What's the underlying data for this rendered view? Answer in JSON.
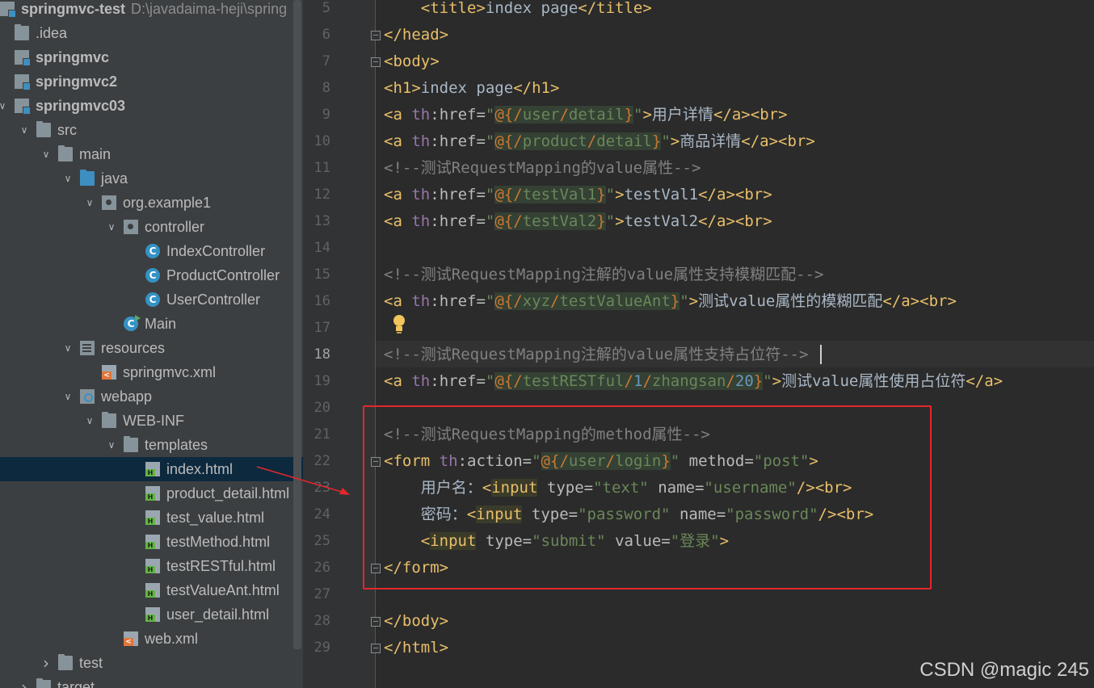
{
  "project_tree": {
    "root": {
      "name": "springmvc-test",
      "path": "D:\\javadaima-heji\\spring"
    },
    "items": [
      {
        "label": "springmvc-test",
        "icon": "module-folder-icon"
      },
      {
        "label": ".idea",
        "icon": "folder-icon"
      },
      {
        "label": "springmvc",
        "icon": "module-folder-icon"
      },
      {
        "label": "springmvc2",
        "icon": "module-folder-icon"
      },
      {
        "label": "springmvc03",
        "icon": "module-folder-icon"
      },
      {
        "label": "src",
        "icon": "folder-icon"
      },
      {
        "label": "main",
        "icon": "folder-icon"
      },
      {
        "label": "java",
        "icon": "source-folder-icon"
      },
      {
        "label": "org.example1",
        "icon": "package-icon"
      },
      {
        "label": "controller",
        "icon": "package-icon"
      },
      {
        "label": "IndexController",
        "icon": "java-class-icon"
      },
      {
        "label": "ProductController",
        "icon": "java-class-icon"
      },
      {
        "label": "UserController",
        "icon": "java-class-icon"
      },
      {
        "label": "Main",
        "icon": "java-main-class-icon"
      },
      {
        "label": "resources",
        "icon": "resources-folder-icon"
      },
      {
        "label": "springmvc.xml",
        "icon": "xml-file-icon"
      },
      {
        "label": "webapp",
        "icon": "web-folder-icon"
      },
      {
        "label": "WEB-INF",
        "icon": "folder-icon"
      },
      {
        "label": "templates",
        "icon": "folder-icon"
      },
      {
        "label": "index.html",
        "icon": "html-file-icon"
      },
      {
        "label": "product_detail.html",
        "icon": "html-file-icon"
      },
      {
        "label": "test_value.html",
        "icon": "html-file-icon"
      },
      {
        "label": "testMethod.html",
        "icon": "html-file-icon"
      },
      {
        "label": "testRESTful.html",
        "icon": "html-file-icon"
      },
      {
        "label": "testValueAnt.html",
        "icon": "html-file-icon"
      },
      {
        "label": "user_detail.html",
        "icon": "html-file-icon"
      },
      {
        "label": "web.xml",
        "icon": "xml-file-icon"
      },
      {
        "label": "test",
        "icon": "folder-icon"
      },
      {
        "label": "target",
        "icon": "excluded-folder-icon"
      }
    ],
    "selected": "index.html"
  },
  "editor": {
    "current_line": 18,
    "line_numbers": [
      "5",
      "6",
      "7",
      "8",
      "9",
      "10",
      "11",
      "12",
      "13",
      "14",
      "15",
      "16",
      "17",
      "18",
      "19",
      "20",
      "21",
      "22",
      "23",
      "24",
      "25",
      "26",
      "27",
      "28",
      "29"
    ],
    "code": {
      "l5": "    <title>index page</title>",
      "l6": "</head>",
      "l7": "<body>",
      "l8": "<h1>index page</h1>",
      "l9": "<a th:href=\"@{/user/detail}\">用户详情</a><br>",
      "l10": "<a th:href=\"@{/product/detail}\">商品详情</a><br>",
      "l11": "<!--测试RequestMapping的value属性-->",
      "l12": "<a th:href=\"@{/testVal1}\">testVal1</a><br>",
      "l13": "<a th:href=\"@{/testVal2}\">testVal2</a><br>",
      "l14": "",
      "l15": "<!--测试RequestMapping注解的value属性支持模糊匹配-->",
      "l16": "<a th:href=\"@{/xyz/testValueAnt}\">测试value属性的模糊匹配</a><br>",
      "l17": "",
      "l18": "<!--测试RequestMapping注解的value属性支持占位符-->",
      "l19": "<a th:href=\"@{/testRESTful/1/zhangsan/20}\">测试value属性使用占位符</a>",
      "l20": "",
      "l21": "<!--测试RequestMapping的method属性-->",
      "l22": "<form th:action=\"@{/user/login}\" method=\"post\">",
      "l23": "    用户名：<input type=\"text\" name=\"username\"/><br>",
      "l24": "    密码：<input type=\"password\" name=\"password\"/><br>",
      "l25": "    <input type=\"submit\" value=\"登录\">",
      "l26": "</form>",
      "l27": "",
      "l28": "</body>",
      "l29": "</html>"
    }
  },
  "colors": {
    "tag": "#e8bf6a",
    "attribute": "#bababa",
    "namespace": "#9876aa",
    "string": "#6a8759",
    "comment": "#808080",
    "annotation_box": "#e3272b"
  },
  "watermark": "CSDN @magic 245"
}
